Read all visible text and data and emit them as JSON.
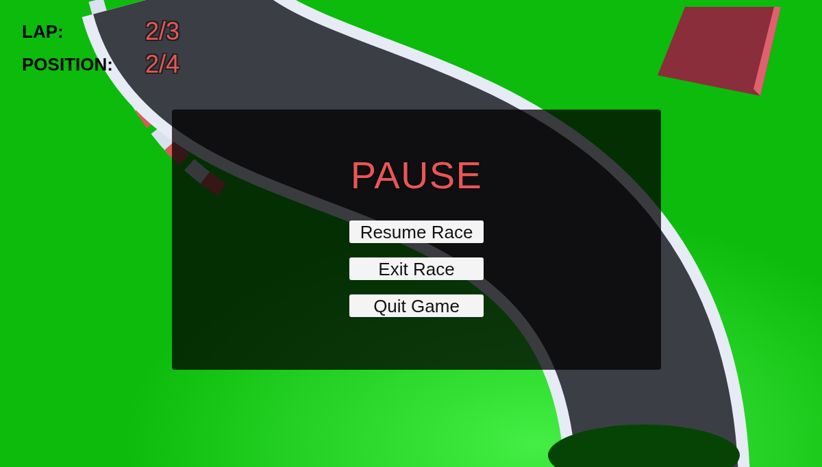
{
  "hud": {
    "stats": [
      {
        "label": "LAP:",
        "value": "2/3"
      },
      {
        "label": "POSITION:",
        "value": "2/4"
      }
    ]
  },
  "pause_menu": {
    "title": "PAUSE",
    "buttons": [
      "Resume Race",
      "Exit Race",
      "Quit Game"
    ]
  }
}
